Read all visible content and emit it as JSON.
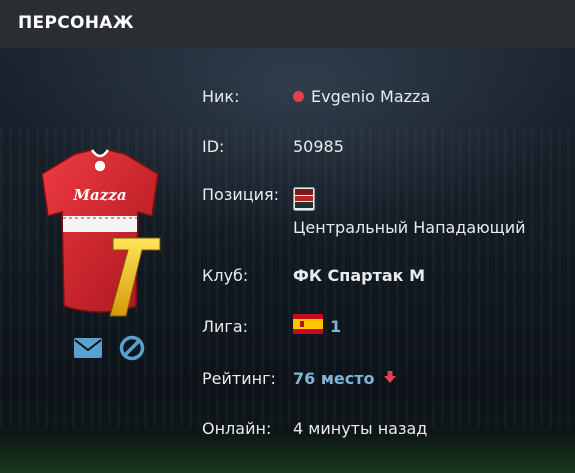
{
  "header": {
    "title": "ПЕРСОНАЖ"
  },
  "player": {
    "shirt_name": "Mazza",
    "shirt_number": "7"
  },
  "rows": {
    "nick": {
      "label": "Ник:",
      "value": "Evgenio Mazza",
      "status_color": "#e0414d"
    },
    "id": {
      "label": "ID:",
      "value": "50985"
    },
    "position": {
      "label": "Позиция:",
      "value": "Центральный Нападающий",
      "icon": "position-badge-icon"
    },
    "club": {
      "label": "Клуб:",
      "value": "ФК Спартак М"
    },
    "league": {
      "label": "Лига:",
      "value": "1",
      "flag": "spain-flag-icon"
    },
    "rating": {
      "label": "Рейтинг:",
      "value": "76 место",
      "trend": "down-arrow-icon",
      "trend_color": "#e0414d"
    },
    "online": {
      "label": "Онлайн:",
      "value": "4 минуты назад"
    }
  },
  "actions": {
    "message_icon": "envelope-icon",
    "block_icon": "block-icon"
  },
  "colors": {
    "link": "#7fb4d8",
    "jersey": "#d8262e",
    "number": "#f2c21b",
    "accent": "#5aa0cf"
  }
}
